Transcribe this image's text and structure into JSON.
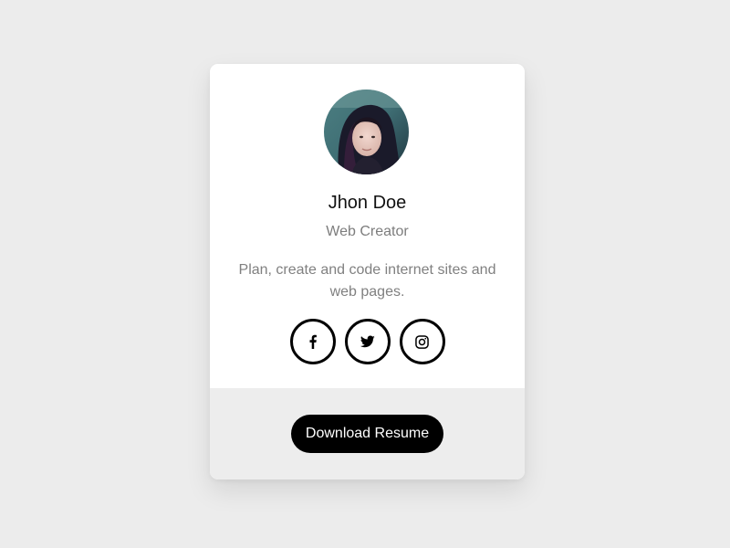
{
  "profile": {
    "name": "Jhon Doe",
    "role": "Web Creator",
    "bio": "Plan, create and code internet sites and web pages.",
    "avatar_alt": "profile-photo"
  },
  "socials": [
    {
      "name": "facebook",
      "icon": "facebook-icon"
    },
    {
      "name": "twitter",
      "icon": "twitter-icon"
    },
    {
      "name": "instagram",
      "icon": "instagram-icon"
    }
  ],
  "footer": {
    "download_label": "Download Resume"
  },
  "colors": {
    "background": "#ececec",
    "card": "#ffffff",
    "footer": "#ededed",
    "button": "#000000",
    "button_text": "#ffffff",
    "muted_text": "#808080"
  }
}
